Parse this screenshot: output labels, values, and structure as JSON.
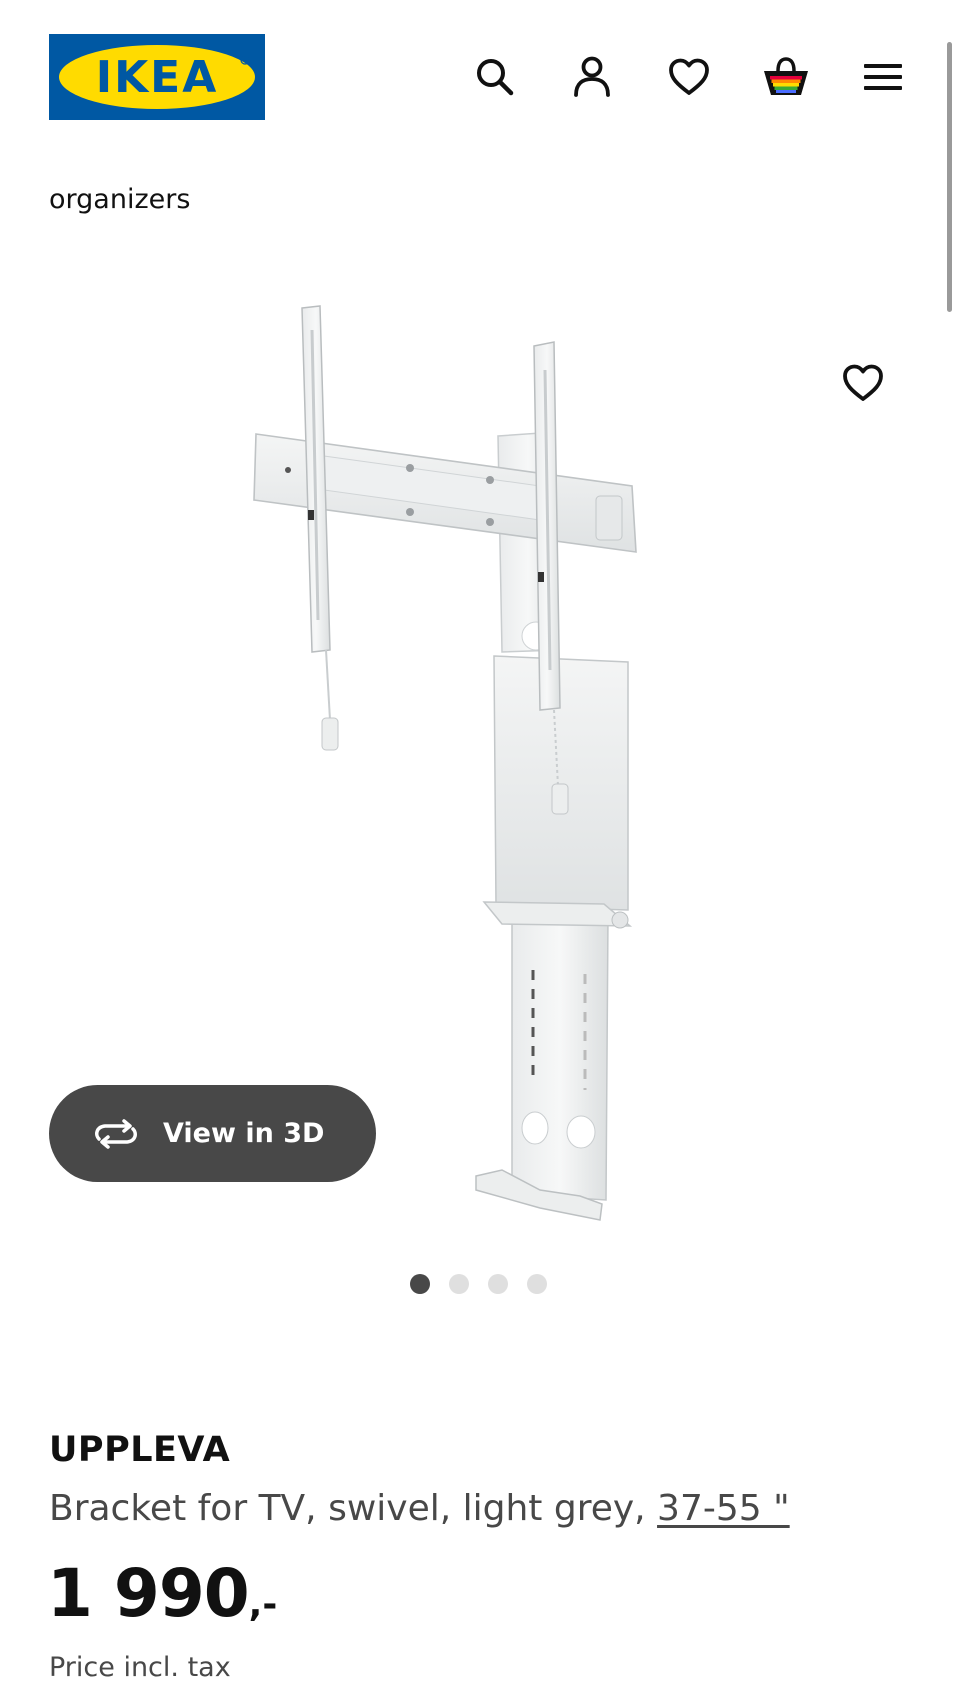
{
  "header": {
    "logo_text": "IKEA",
    "logo_colors": {
      "background": "#0058a3",
      "oval": "#ffdb00",
      "text": "#0058a3"
    },
    "icons": [
      "search-icon",
      "profile-icon",
      "heart-icon",
      "shopping-bag-icon",
      "hamburger-menu-icon"
    ]
  },
  "breadcrumb": {
    "current": "organizers"
  },
  "gallery": {
    "image_subject": "wall-mounted-tv-bracket",
    "wishlist_icon": "heart-icon",
    "view3d_label": "View in 3D",
    "view3d_icon": "rotate-3d-icon",
    "total_images": 4,
    "active_index": 0
  },
  "product": {
    "name": "UPPLEVA",
    "description_prefix": "Bracket for TV, swivel, light grey, ",
    "size_link": "37-55 \"",
    "price_integer": "1 990",
    "price_suffix": ",-",
    "price_note": "Price incl. tax"
  },
  "colors": {
    "primary_text": "#111111",
    "secondary_text": "#484848",
    "button_dark": "#484848",
    "dot_inactive": "#dfdfdf"
  }
}
